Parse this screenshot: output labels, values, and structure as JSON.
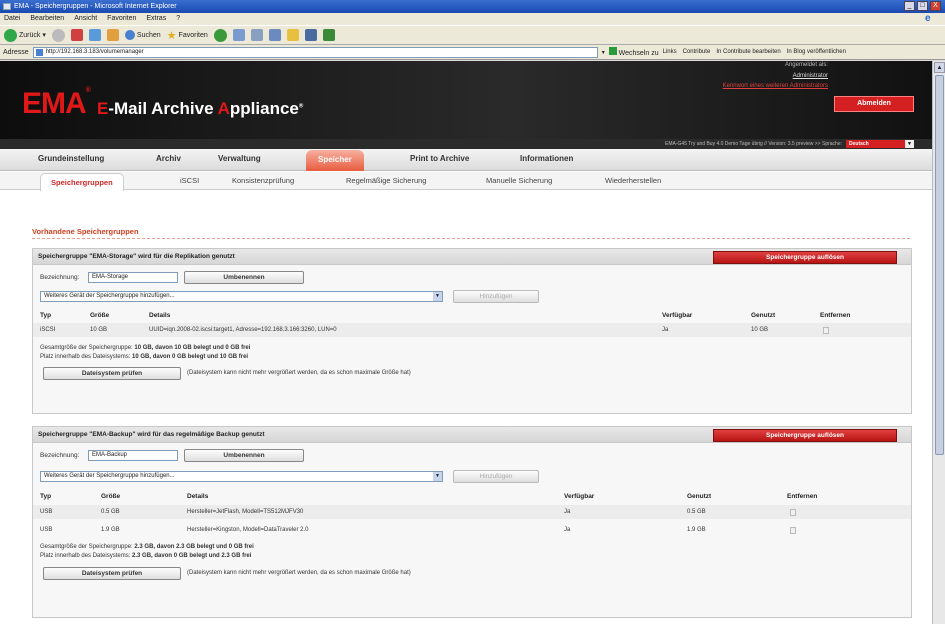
{
  "window": {
    "title": "EMA - Speichergruppen - Microsoft Internet Explorer",
    "controls": [
      "_",
      "□",
      "X"
    ]
  },
  "menubar": [
    "Datei",
    "Bearbeiten",
    "Ansicht",
    "Favoriten",
    "Extras",
    "?"
  ],
  "toolbar": {
    "back": "Zurück",
    "search": "Suchen",
    "favorites": "Favoriten"
  },
  "address": {
    "label": "Adresse",
    "url": "http://192.168.3.183/volumemanager",
    "go": "Wechseln zu",
    "links": [
      "Links",
      "Contribute",
      "In Contribute bearbeiten",
      "In Blog veröffentlichen"
    ]
  },
  "header": {
    "logo": "EMA",
    "logo_mark": "®",
    "title_e": "E",
    "title_dash_mail": "-Mail Archive ",
    "title_a": "A",
    "title_ppliance": "ppliance",
    "title_tm": "®",
    "user_label": "Angemeldet als:",
    "user_name": "Administrator",
    "password_link": "Kennwort eines weiteren Administrators",
    "logout": "Abmelden",
    "version": "EMA-G45 Try and Buy 4.0 Demo Tage übrig // Version: 3.5 preview >> Sprache:",
    "language": "Deutsch"
  },
  "main_tabs": [
    "Grundeinstellung",
    "Archiv",
    "Verwaltung",
    "Speicher",
    "Print to Archive",
    "Informationen"
  ],
  "main_tabs_active": 3,
  "sub_tabs": [
    "Speichergruppen",
    "iSCSI",
    "Konsistenzprüfung",
    "Regelmäßige Sicherung",
    "Manuelle Sicherung",
    "Wiederherstellen"
  ],
  "section_title": "Vorhandene Speichergruppen",
  "groups": [
    {
      "title": "Speichergruppe \"EMA-Storage\" wird für die Replikation genutzt",
      "dissolve": "Speichergruppe auflösen",
      "name_label": "Bezeichnung:",
      "name_value": "EMA-Storage",
      "rename": "Umbenennen",
      "add_select": "Weiteres Gerät der Speichergruppe hinzufügen...",
      "add_btn": "Hinzufügen",
      "cols": [
        "Typ",
        "Größe",
        "Details",
        "Verfügbar",
        "Genutzt",
        "Entfernen"
      ],
      "rows": [
        [
          "iSCSI",
          "10 GB",
          "UUID=iqn.2008-02.iscsi:target1, Adresse=192.168.3.166:3260, LUN=0",
          "Ja",
          "10 GB"
        ]
      ],
      "sum1_label": "Gesamtgröße der Speichergruppe:",
      "sum1_value": "10 GB, davon 10 GB belegt und 0 GB frei",
      "sum2_label": "Platz innerhalb des Dateisystems:",
      "sum2_value": "10 GB, davon 0 GB belegt und 10 GB frei",
      "check": "Dateisystem prüfen",
      "check_note": "(Dateisystem kann nicht mehr vergrößert werden, da es schon maximale Größe hat)"
    },
    {
      "title": "Speichergruppe \"EMA-Backup\" wird für das regelmäßige Backup genutzt",
      "dissolve": "Speichergruppe auflösen",
      "name_label": "Bezeichnung:",
      "name_value": "EMA-Backup",
      "rename": "Umbenennen",
      "add_select": "Weiteres Gerät der Speichergruppe hinzufügen...",
      "add_btn": "Hinzufügen",
      "cols": [
        "Typ",
        "Größe",
        "Details",
        "Verfügbar",
        "Genutzt",
        "Entfernen"
      ],
      "rows": [
        [
          "USB",
          "0.5 GB",
          "Hersteller=JetFlash, Modell=TS512MJFV30",
          "Ja",
          "0.5 GB"
        ],
        [
          "USB",
          "1.9 GB",
          "Hersteller=Kingston, Modell=DataTraveler 2.0",
          "Ja",
          "1.9 GB"
        ]
      ],
      "sum1_label": "Gesamtgröße der Speichergruppe:",
      "sum1_value": "2.3 GB, davon 2.3 GB belegt und 0 GB frei",
      "sum2_label": "Platz innerhalb des Dateisystems:",
      "sum2_value": "2.3 GB, davon 0 GB belegt und 2.3 GB frei",
      "check": "Dateisystem prüfen",
      "check_note": "(Dateisystem kann nicht mehr vergrößert werden, da es schon maximale Größe hat)"
    }
  ],
  "colors": {
    "brand_red": "#e01818",
    "button_red": "#c41c1c",
    "header_bg": "#1a1a1a"
  }
}
